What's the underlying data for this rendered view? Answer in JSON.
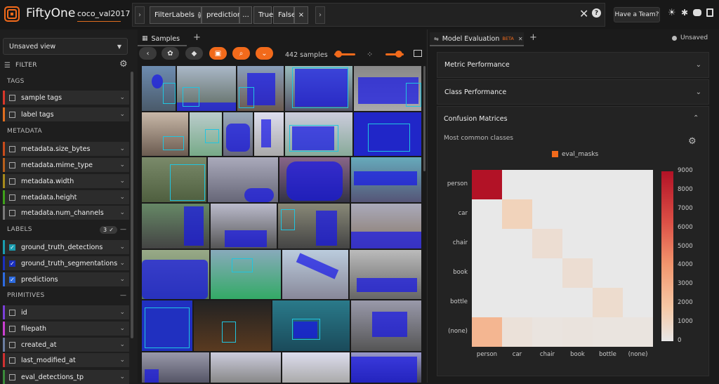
{
  "app": {
    "name": "FiftyOne",
    "dataset": "coco_val2017",
    "have_team": "Have a Team?"
  },
  "filterbar": {
    "filter_labels": "FilterLabels",
    "field": "predictions",
    "dots": "...",
    "true_label": "True",
    "false_label": "False",
    "clear": "×",
    "help": "?"
  },
  "sidebar": {
    "view": "Unsaved view",
    "filter": "FILTER",
    "tags_section": "TAGS",
    "tags": [
      {
        "label": "sample tags",
        "color": "#d9372a"
      },
      {
        "label": "label tags",
        "color": "#e06d1f"
      }
    ],
    "metadata_section": "METADATA",
    "metadata": [
      {
        "label": "metadata.size_bytes",
        "color": "#c84b1b"
      },
      {
        "label": "metadata.mime_type",
        "color": "#b85f1b"
      },
      {
        "label": "metadata.width",
        "color": "#a68a1b"
      },
      {
        "label": "metadata.height",
        "color": "#3fa11a"
      },
      {
        "label": "metadata.num_channels",
        "color": "#7a7a7a"
      }
    ],
    "labels_section": "LABELS",
    "labels_count": "3 ✓",
    "labels": [
      {
        "label": "ground_truth_detections",
        "color": "#1a9db0",
        "checked": true
      },
      {
        "label": "ground_truth_segmentations",
        "color": "#1a2fbf",
        "checked": true
      },
      {
        "label": "predictions",
        "color": "#2d6be0",
        "checked": true
      }
    ],
    "primitives_section": "PRIMITIVES",
    "primitives": [
      {
        "label": "id",
        "color": "#7a3fd9"
      },
      {
        "label": "filepath",
        "color": "#c93fd0"
      },
      {
        "label": "created_at",
        "color": "#6b7da0"
      },
      {
        "label": "last_modified_at",
        "color": "#d03030"
      },
      {
        "label": "eval_detections_tp",
        "color": "#3a8a3a"
      }
    ]
  },
  "samples": {
    "tab": "Samples",
    "add": "+",
    "count": "442 samples"
  },
  "evaluation": {
    "tab": "Model Evaluation",
    "beta": "BETA",
    "close": "✕",
    "add": "+",
    "unsaved": "Unsaved",
    "sections": [
      {
        "label": "Metric Performance",
        "state": "collapsed"
      },
      {
        "label": "Class Performance",
        "state": "collapsed"
      },
      {
        "label": "Confusion Matrices",
        "state": "expanded"
      }
    ],
    "subtitle": "Most common classes",
    "legend": "eval_masks",
    "legend_color": "#f26a1b"
  },
  "chart_data": {
    "type": "heatmap",
    "x_categories": [
      "person",
      "car",
      "chair",
      "book",
      "bottle",
      "(none)"
    ],
    "y_categories": [
      "person",
      "car",
      "chair",
      "book",
      "bottle",
      "(none)"
    ],
    "values": [
      [
        9000,
        0,
        0,
        0,
        0,
        0
      ],
      [
        0,
        1200,
        0,
        0,
        0,
        0
      ],
      [
        0,
        0,
        600,
        0,
        0,
        0
      ],
      [
        0,
        0,
        0,
        600,
        0,
        0
      ],
      [
        0,
        0,
        0,
        0,
        700,
        0
      ],
      [
        2600,
        400,
        250,
        300,
        250,
        250
      ]
    ],
    "colorbar": {
      "min": 0,
      "max": 9000,
      "ticks": [
        "9000",
        "8000",
        "7000",
        "6000",
        "5000",
        "4000",
        "3000",
        "2000",
        "1000",
        "0"
      ]
    }
  }
}
